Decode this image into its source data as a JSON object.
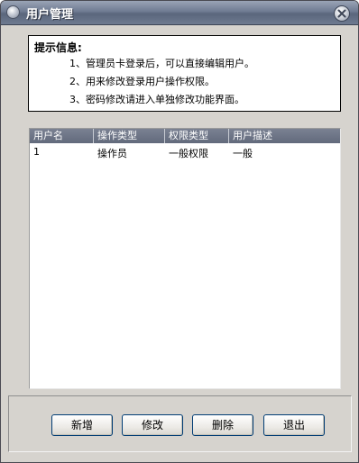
{
  "window": {
    "title": "用户管理",
    "close_icon": "close-icon"
  },
  "info": {
    "title": "提示信息:",
    "lines": [
      "1、管理员卡登录后，可以直接编辑用户。",
      "2、用来修改登录用户操作权限。",
      "3、密码修改请进入单独修改功能界面。"
    ]
  },
  "table": {
    "columns": [
      "用户名",
      "操作类型",
      "权限类型",
      "用户描述"
    ],
    "rows": [
      [
        "1",
        "操作员",
        "一般权限",
        "一般"
      ]
    ]
  },
  "buttons": {
    "add": "新增",
    "edit": "修改",
    "delete": "删除",
    "exit": "退出"
  },
  "colors": {
    "titlebar": "#6f7b92",
    "window_bg": "#d6d3ce",
    "table_header": "#6e7588",
    "button_border": "#003c74"
  }
}
